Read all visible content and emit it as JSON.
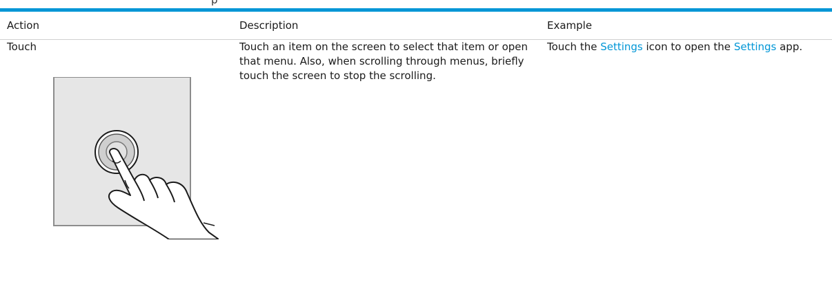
{
  "header_clip": "p",
  "accent_color": "#0096d6",
  "columns": {
    "action": "Action",
    "description": "Description",
    "example": "Example"
  },
  "rows": [
    {
      "action": "Touch",
      "description": "Touch an item on the screen to select that item or open that menu. Also, when scrolling through menus, briefly touch the screen to stop the scrolling.",
      "example": {
        "before": "Touch the ",
        "link1": "Settings",
        "middle": " icon to open the ",
        "link2": "Settings",
        "after": " app."
      },
      "illustration_icon": "touch-gesture-icon"
    }
  ]
}
